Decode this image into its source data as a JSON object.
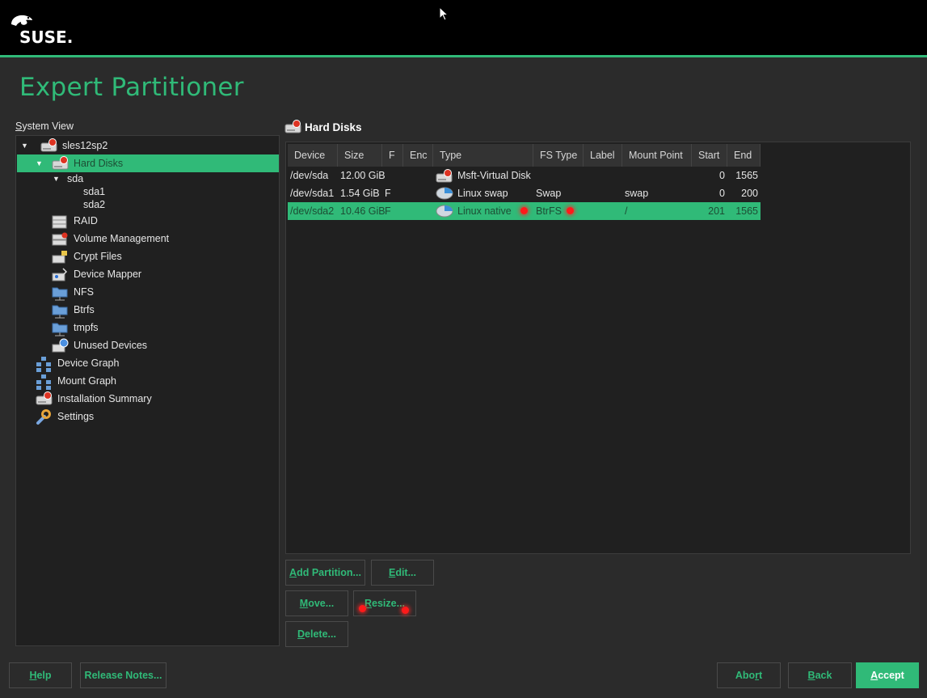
{
  "header": {
    "brand": "SUSE."
  },
  "page": {
    "title": "Expert Partitioner"
  },
  "system_view": {
    "label_prefix": "S",
    "label_rest": "ystem View",
    "tree": [
      {
        "label": "sles12sp2",
        "icon": "harddisk-icon"
      },
      {
        "label": "Hard Disks",
        "icon": "harddisk-icon",
        "selected": true
      },
      {
        "label": "sda"
      },
      {
        "label": "sda1"
      },
      {
        "label": "sda2"
      },
      {
        "label": "RAID",
        "icon": "raid-icon"
      },
      {
        "label": "Volume Management",
        "icon": "volume-icon"
      },
      {
        "label": "Crypt Files",
        "icon": "crypt-icon"
      },
      {
        "label": "Device Mapper",
        "icon": "device-mapper-icon"
      },
      {
        "label": "NFS",
        "icon": "folder-network-icon"
      },
      {
        "label": "Btrfs",
        "icon": "folder-network-icon"
      },
      {
        "label": "tmpfs",
        "icon": "folder-network-icon"
      },
      {
        "label": "Unused Devices",
        "icon": "unused-devices-icon"
      },
      {
        "label": "Device Graph",
        "icon": "graph-icon"
      },
      {
        "label": "Mount Graph",
        "icon": "graph-icon"
      },
      {
        "label": "Installation Summary",
        "icon": "harddisk-icon"
      },
      {
        "label": "Settings",
        "icon": "wrench-icon"
      }
    ]
  },
  "hard_disks": {
    "title": "Hard Disks",
    "columns": [
      "Device",
      "Size",
      "F",
      "Enc",
      "Type",
      "FS Type",
      "Label",
      "Mount Point",
      "Start",
      "End"
    ],
    "rows": [
      {
        "device": "/dev/sda",
        "size": "12.00 GiB",
        "f": "",
        "enc": "",
        "type": "Msft-Virtual Disk",
        "fs_type": "",
        "label": "",
        "mount": "",
        "start": "0",
        "end": "1565"
      },
      {
        "device": "/dev/sda1",
        "size": "1.54 GiB",
        "f": "F",
        "enc": "",
        "type": "Linux swap",
        "fs_type": "Swap",
        "label": "",
        "mount": "swap",
        "start": "0",
        "end": "200"
      },
      {
        "device": "/dev/sda2",
        "size": "10.46 GiB",
        "f": "F",
        "enc": "",
        "type": "Linux native",
        "fs_type": "BtrFS",
        "label": "",
        "mount": "/",
        "start": "201",
        "end": "1565",
        "selected": true
      }
    ]
  },
  "actions": {
    "add_partition": {
      "u": "A",
      "rest": "dd Partition..."
    },
    "edit": {
      "u": "E",
      "rest": "dit..."
    },
    "move": {
      "u": "M",
      "rest": "ove..."
    },
    "resize": {
      "u": "R",
      "rest": "esize..."
    },
    "delete": {
      "u": "D",
      "rest": "elete..."
    }
  },
  "footer": {
    "help": {
      "u": "H",
      "rest": "elp"
    },
    "release_notes": "Release Notes...",
    "abort": {
      "pre": "Abo",
      "u": "r",
      "rest": "t"
    },
    "back": {
      "u": "B",
      "rest": "ack"
    },
    "accept": {
      "u": "A",
      "rest": "ccept"
    }
  },
  "colors": {
    "accent": "#30ba78",
    "marker": "#ff1a1a"
  }
}
